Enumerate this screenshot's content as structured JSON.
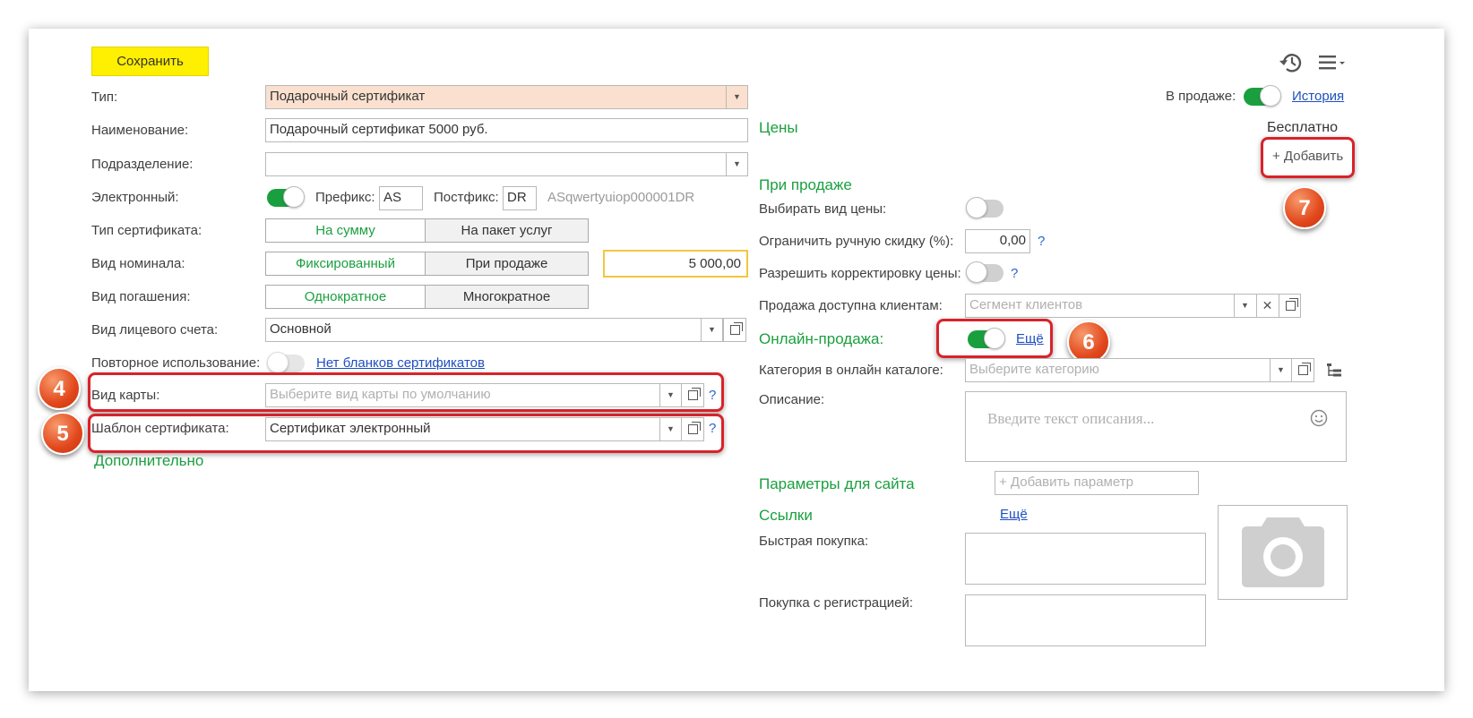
{
  "toolbar": {
    "save_label": "Сохранить",
    "history_icon": "history-icon",
    "menu_icon": "menu-icon"
  },
  "left": {
    "type": {
      "label": "Тип:",
      "value": "Подарочный сертификат"
    },
    "name": {
      "label": "Наименование:",
      "value": "Подарочный сертификат 5000 руб."
    },
    "division": {
      "label": "Подразделение:",
      "value": ""
    },
    "electronic": {
      "label": "Электронный:",
      "on": true,
      "prefix_label": "Префикс:",
      "prefix": "AS",
      "postfix_label": "Постфикс:",
      "postfix": "DR",
      "code": "ASqwertyuiop000001DR"
    },
    "cert_type": {
      "label": "Тип сертификата:",
      "options": [
        "На сумму",
        "На пакет услуг"
      ],
      "selected": 0
    },
    "nominal_kind": {
      "label": "Вид номинала:",
      "options": [
        "Фиксированный",
        "При продаже"
      ],
      "selected": 0,
      "amount": "5 000,00"
    },
    "redemption": {
      "label": "Вид погашения:",
      "options": [
        "Однократное",
        "Многократное"
      ],
      "selected": 0
    },
    "account_kind": {
      "label": "Вид лицевого счета:",
      "value": "Основной"
    },
    "reuse": {
      "label": "Повторное использование:",
      "on": false,
      "link": "Нет бланков сертификатов"
    },
    "card_kind": {
      "label": "Вид карты:",
      "placeholder": "Выберите вид карты по умолчанию",
      "help": "?"
    },
    "template": {
      "label": "Шаблон сертификата:",
      "value": "Сертификат электронный",
      "help": "?"
    },
    "additional": "Дополнительно"
  },
  "right": {
    "on_sale": {
      "label": "В продаже:",
      "on": true,
      "history_link": "История"
    },
    "prices": {
      "title": "Цены",
      "status": "Бесплатно",
      "add_button": "+ Добавить"
    },
    "on_sell": {
      "title": "При продаже",
      "choose_price": {
        "label": "Выбирать вид цены:",
        "on": false
      },
      "limit_discount": {
        "label": "Ограничить ручную скидку (%):",
        "value": "0,00",
        "help": "?"
      },
      "allow_correction": {
        "label": "Разрешить корректировку цены:",
        "on": false,
        "help": "?"
      },
      "clients": {
        "label": "Продажа доступна клиентам:",
        "placeholder": "Сегмент клиентов"
      }
    },
    "online": {
      "title": "Онлайн-продажа:",
      "on": true,
      "more_link": "Ещё"
    },
    "category": {
      "label": "Категория в онлайн каталоге:",
      "placeholder": "Выберите категорию"
    },
    "description": {
      "label": "Описание:",
      "placeholder": "Введите текст описания..."
    },
    "site_params": {
      "title": "Параметры для сайта",
      "add_placeholder": "+ Добавить параметр"
    },
    "links": {
      "title": "Ссылки",
      "more_link": "Ещё",
      "quick_buy": "Быстрая покупка:",
      "reg_buy": "Покупка с регистрацией:"
    }
  },
  "callouts": [
    "4",
    "5",
    "6",
    "7"
  ],
  "colors": {
    "accent": "#1a9f3f",
    "save": "#ffef00",
    "highlight": "#fbe0cf",
    "callout": "#d8232a"
  }
}
